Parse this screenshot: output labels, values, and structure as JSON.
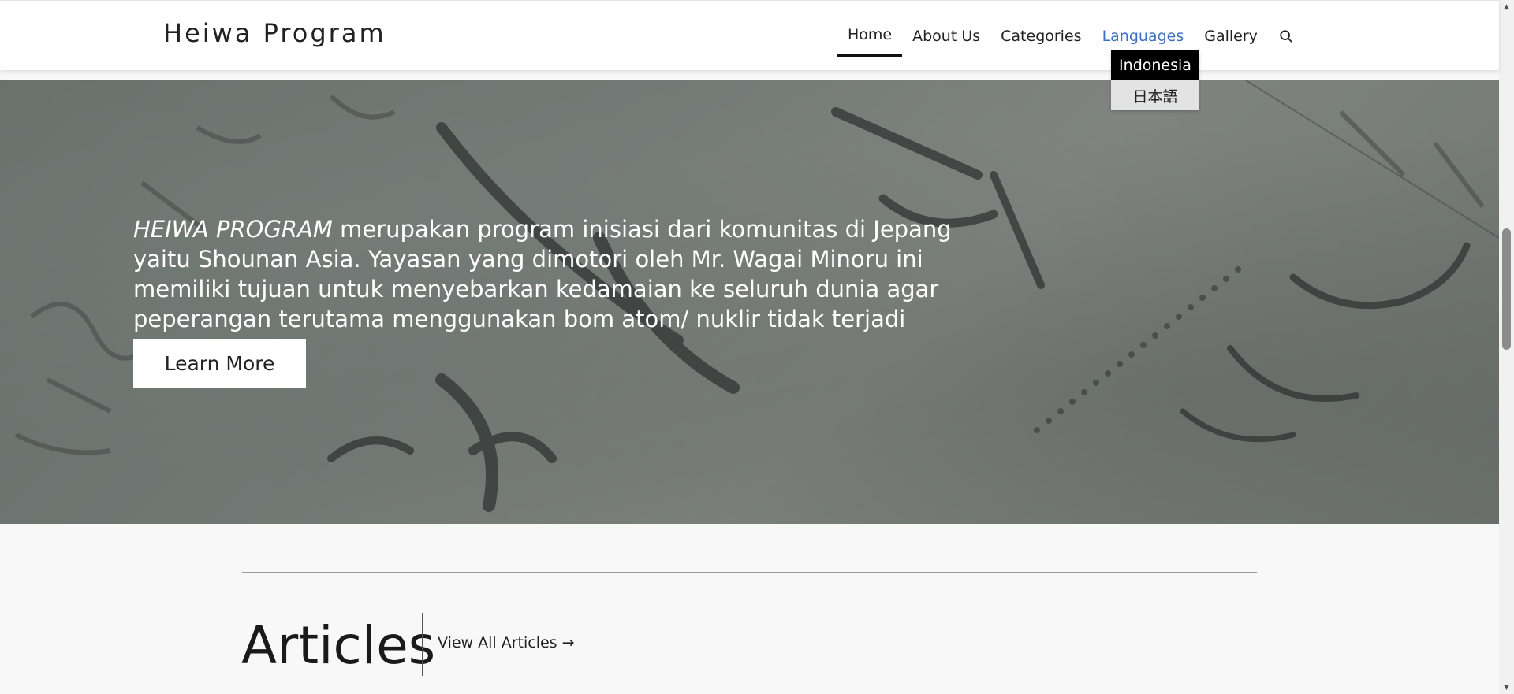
{
  "header": {
    "brand": "Heiwa Program",
    "nav": [
      {
        "label": "Home"
      },
      {
        "label": "About Us"
      },
      {
        "label": "Categories"
      },
      {
        "label": "Languages"
      },
      {
        "label": "Gallery"
      }
    ],
    "search_icon": "search-icon"
  },
  "languages_dropdown": {
    "options": [
      "Indonesia",
      "日本語"
    ],
    "selected": "Indonesia"
  },
  "hero": {
    "brand_emphasis": "HEIWA PROGRAM",
    "description": " merupakan program inisiasi dari komunitas di Jepang yaitu Shounan Asia. Yayasan yang dimotori oleh Mr. Wagai Minoru ini memiliki tujuan untuk menyebarkan kedamaian ke seluruh dunia agar peperangan terutama menggunakan bom atom/ nuklir tidak terjadi lagi.",
    "button": "Learn More"
  },
  "articles": {
    "title": "Articles",
    "view_all": "View All Articles →"
  },
  "colors": {
    "link_hover": "#3f6fc4",
    "dropdown_selected_bg": "#000000",
    "dropdown_bg": "#e3e3e3"
  }
}
